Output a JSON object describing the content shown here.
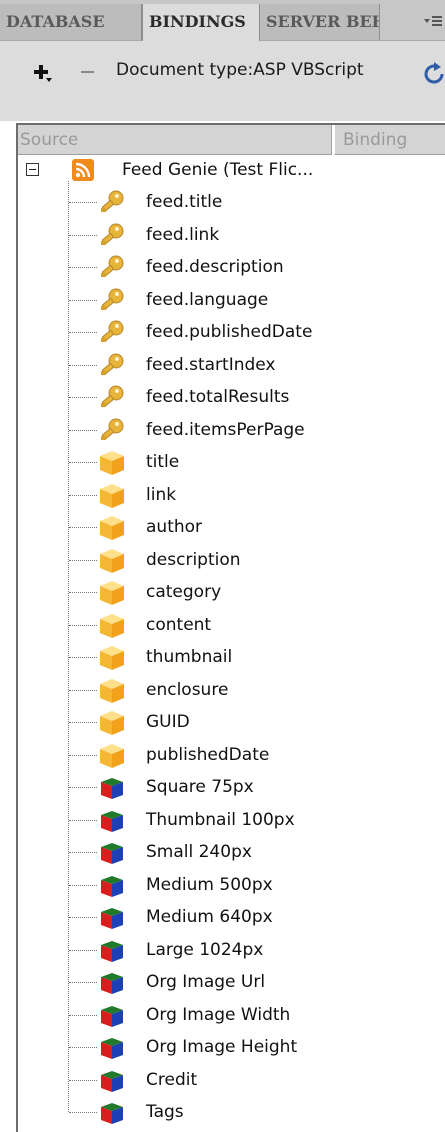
{
  "tabs": [
    {
      "label": "DATABASE",
      "active": false
    },
    {
      "label": "BINDINGS",
      "active": true
    },
    {
      "label": "SERVER BEH",
      "active": false
    }
  ],
  "toolbar": {
    "doc_type_label": "Document type:ASP VBScript",
    "icons": [
      "plus-icon",
      "minus-icon",
      "refresh-icon",
      "panel-menu-icon"
    ]
  },
  "columns": {
    "source": "Source",
    "binding": "Binding"
  },
  "root": {
    "label": "Feed Genie (Test Flic...",
    "icon": "rss-feed-icon",
    "expanded": true
  },
  "items": [
    {
      "label": "feed.title",
      "icon": "key-icon"
    },
    {
      "label": "feed.link",
      "icon": "key-icon"
    },
    {
      "label": "feed.description",
      "icon": "key-icon"
    },
    {
      "label": "feed.language",
      "icon": "key-icon"
    },
    {
      "label": "feed.publishedDate",
      "icon": "key-icon"
    },
    {
      "label": "feed.startIndex",
      "icon": "key-icon"
    },
    {
      "label": "feed.totalResults",
      "icon": "key-icon"
    },
    {
      "label": "feed.itemsPerPage",
      "icon": "key-icon"
    },
    {
      "label": "title",
      "icon": "box-icon"
    },
    {
      "label": "link",
      "icon": "box-icon"
    },
    {
      "label": "author",
      "icon": "box-icon"
    },
    {
      "label": "description",
      "icon": "box-icon"
    },
    {
      "label": "category",
      "icon": "box-icon"
    },
    {
      "label": "content",
      "icon": "box-icon"
    },
    {
      "label": "thumbnail",
      "icon": "box-icon"
    },
    {
      "label": "enclosure",
      "icon": "box-icon"
    },
    {
      "label": "GUID",
      "icon": "box-icon"
    },
    {
      "label": "publishedDate",
      "icon": "box-icon"
    },
    {
      "label": "Square 75px",
      "icon": "rgb-cube-icon"
    },
    {
      "label": "Thumbnail 100px",
      "icon": "rgb-cube-icon"
    },
    {
      "label": "Small 240px",
      "icon": "rgb-cube-icon"
    },
    {
      "label": "Medium 500px",
      "icon": "rgb-cube-icon"
    },
    {
      "label": "Medium 640px",
      "icon": "rgb-cube-icon"
    },
    {
      "label": "Large 1024px",
      "icon": "rgb-cube-icon"
    },
    {
      "label": "Org Image Url",
      "icon": "rgb-cube-icon"
    },
    {
      "label": "Org Image Width",
      "icon": "rgb-cube-icon"
    },
    {
      "label": "Org Image Height",
      "icon": "rgb-cube-icon"
    },
    {
      "label": "Credit",
      "icon": "rgb-cube-icon"
    },
    {
      "label": "Tags",
      "icon": "rgb-cube-icon"
    }
  ]
}
